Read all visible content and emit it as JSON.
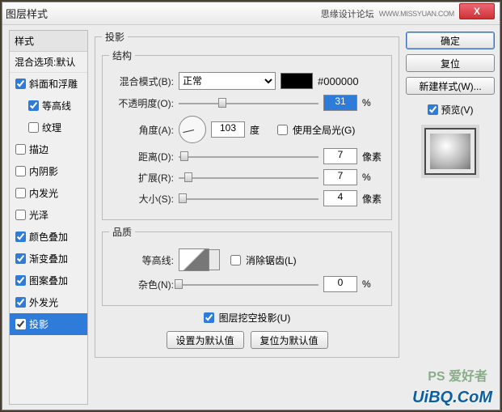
{
  "window": {
    "title": "图层样式"
  },
  "titlebar": {
    "forum": "思缘设计论坛",
    "forum_url": "WWW.MISSYUAN.COM",
    "close": "X"
  },
  "styles": {
    "header": "样式",
    "sub": "混合选项:默认",
    "items": [
      {
        "label": "斜面和浮雕",
        "checked": true,
        "indent": false
      },
      {
        "label": "等高线",
        "checked": true,
        "indent": true
      },
      {
        "label": "纹理",
        "checked": false,
        "indent": true
      },
      {
        "label": "描边",
        "checked": false,
        "indent": false
      },
      {
        "label": "内阴影",
        "checked": false,
        "indent": false
      },
      {
        "label": "内发光",
        "checked": false,
        "indent": false
      },
      {
        "label": "光泽",
        "checked": false,
        "indent": false
      },
      {
        "label": "颜色叠加",
        "checked": true,
        "indent": false
      },
      {
        "label": "渐变叠加",
        "checked": true,
        "indent": false
      },
      {
        "label": "图案叠加",
        "checked": true,
        "indent": false
      },
      {
        "label": "外发光",
        "checked": true,
        "indent": false
      },
      {
        "label": "投影",
        "checked": true,
        "indent": false,
        "selected": true
      }
    ]
  },
  "dropShadow": {
    "panel_title": "投影",
    "structure": {
      "legend": "结构",
      "blend_label": "混合模式(B):",
      "blend_value": "正常",
      "color_hex": "#000000",
      "opacity_label": "不透明度(O):",
      "opacity_value": "31",
      "opacity_unit": "%",
      "angle_label": "角度(A):",
      "angle_value": "103",
      "angle_unit": "度",
      "global_light_label": "使用全局光(G)",
      "global_light_checked": false,
      "distance_label": "距离(D):",
      "distance_value": "7",
      "distance_unit": "像素",
      "spread_label": "扩展(R):",
      "spread_value": "7",
      "spread_unit": "%",
      "size_label": "大小(S):",
      "size_value": "4",
      "size_unit": "像素"
    },
    "quality": {
      "legend": "品质",
      "contour_label": "等高线:",
      "antialias_label": "消除锯齿(L)",
      "antialias_checked": false,
      "noise_label": "杂色(N):",
      "noise_value": "0",
      "noise_unit": "%"
    },
    "knockout_label": "图层挖空投影(U)",
    "knockout_checked": true,
    "set_default": "设置为默认值",
    "reset_default": "复位为默认值"
  },
  "right": {
    "ok": "确定",
    "cancel": "复位",
    "new_style": "新建样式(W)...",
    "preview_label": "预览(V)",
    "preview_checked": true
  },
  "watermark": {
    "main": "UiBQ.CoM",
    "sub": "PS 爱好者"
  }
}
